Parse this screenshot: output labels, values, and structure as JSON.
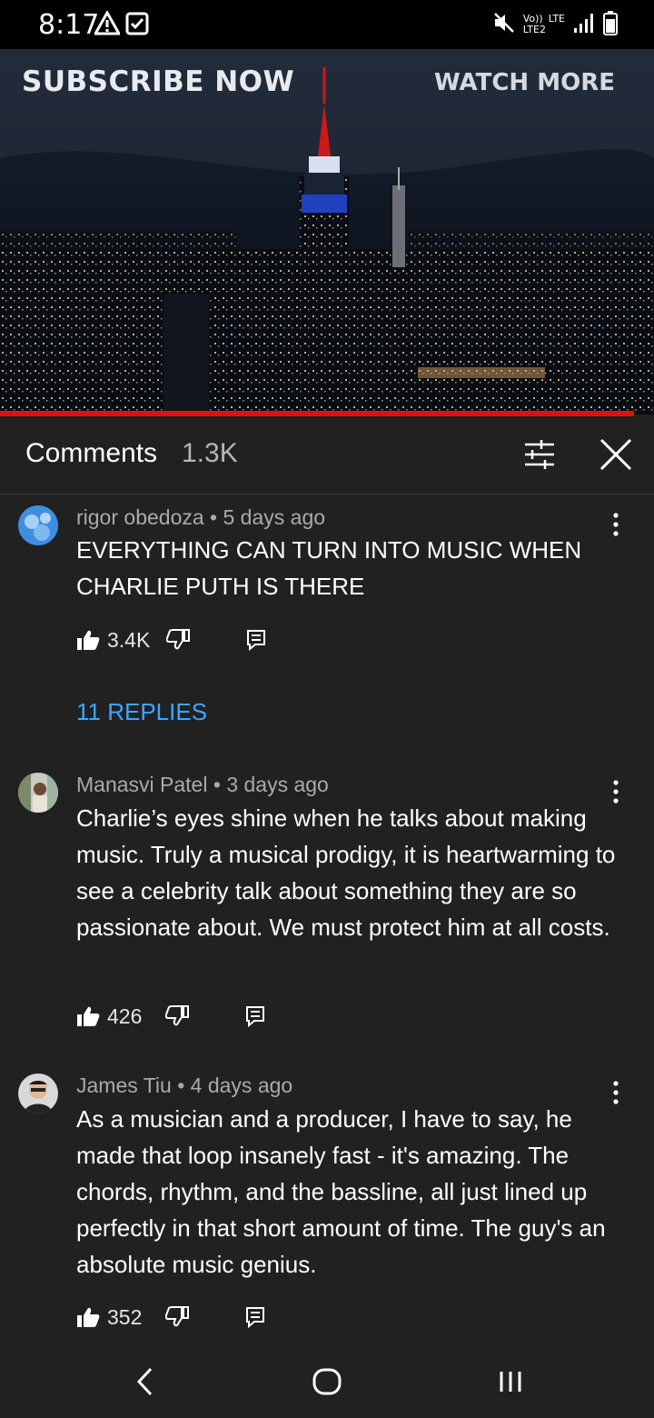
{
  "status_bar": {
    "time": "8:17",
    "network_volte": "Vo))",
    "network_lte": "LTE",
    "network_lte2": "LTE2"
  },
  "video": {
    "overlay_left": "SUBSCRIBE NOW",
    "overlay_right": "WATCH MORE",
    "progress_fraction": 0.97
  },
  "comments_header": {
    "title": "Comments",
    "count": "1.3K"
  },
  "comments": [
    {
      "author": "rigor obedoza",
      "time": "5 days ago",
      "text": "EVERYTHING CAN TURN INTO MUSIC WHEN CHARLIE PUTH IS THERE",
      "likes": "3.4K",
      "replies": "11 REPLIES"
    },
    {
      "author": "Manasvi Patel",
      "time": "3 days ago",
      "text": "Charlie’s eyes shine when he talks about making music. Truly a musical prodigy, it is heartwarming to see a celebrity talk about something they are so passionate about. We must protect him at all costs.",
      "likes": "426"
    },
    {
      "author": "James Tiu",
      "time": "4 days ago",
      "text": "As a musician and a producer, I have to say, he made that loop insanely fast - it's amazing. The chords, rhythm, and the bassline, all just lined up perfectly in that short amount of time. The guy's an absolute music genius.",
      "likes": "352"
    }
  ],
  "meta_separator": "•",
  "colors": {
    "background": "#212121",
    "link": "#3ea6ff",
    "progress": "#e01010",
    "meta": "#aaaaaa"
  },
  "icons": {
    "status": [
      "warning-icon",
      "checkbox-icon",
      "mute-icon",
      "signal-icon",
      "battery-icon"
    ],
    "header": [
      "filter-icon",
      "close-icon"
    ],
    "comment_actions": [
      "thumbs-up-icon",
      "thumbs-down-icon",
      "reply-icon",
      "more-vert-icon"
    ],
    "nav": [
      "back-icon",
      "home-icon",
      "recents-icon"
    ]
  }
}
